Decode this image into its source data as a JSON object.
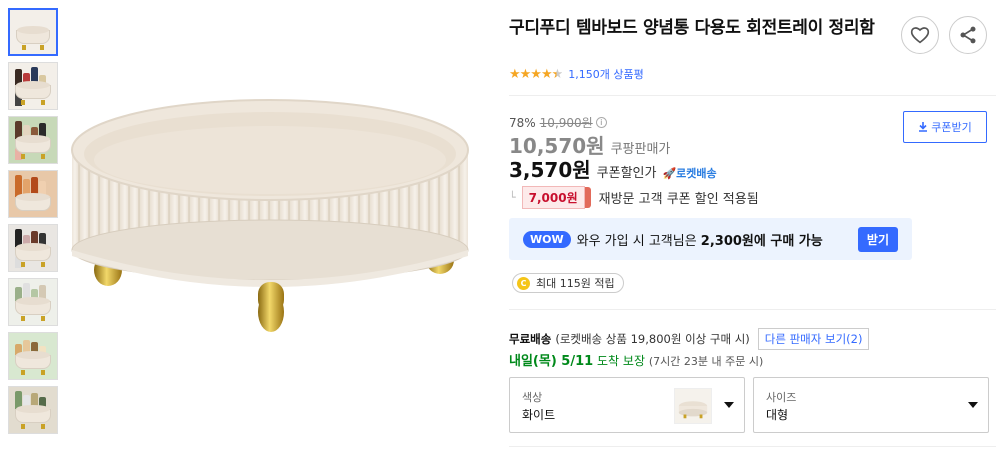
{
  "product": {
    "title": "구디푸디 템바보드 양념통 다용도 회전트레이 정리함",
    "rating_stars": "★★★★★",
    "rating_value": 4.5,
    "review_count": "1,150개 상품평"
  },
  "pricing": {
    "discount_rate": "78%",
    "original_price": "10,900원",
    "info_symbol": "i",
    "coupang_price": "10,570원",
    "coupang_price_label": "쿠팡판매가",
    "coupon_price": "3,570원",
    "coupon_price_label": "쿠폰할인가",
    "rocket_label": "🚀로켓배송",
    "revisit_corner": "└",
    "revisit_price": "7,000원",
    "revisit_text": "재방문 고객 쿠폰 할인 적용됨",
    "coupon_button": "쿠폰받기"
  },
  "wow": {
    "badge": "WOW",
    "text_prefix": "와우 가입 시 고객님은 ",
    "text_amount": "2,300원에 구매 가능",
    "join_button": "받기"
  },
  "reward": {
    "coin": "C",
    "text": "최대 115원 적립"
  },
  "shipping": {
    "free_label": "무료배송",
    "condition": "(로켓배송 상품 19,800원 이상 구매 시)",
    "other_seller": "다른 판매자 보기(2)",
    "arrival_day": "내일(목) 5/11",
    "arrival_suffix": "도착 보장",
    "arrival_note": "(7시간 23분 내 주문 시)"
  },
  "options": [
    {
      "label": "색상",
      "value": "화이트"
    },
    {
      "label": "사이즈",
      "value": "대형"
    }
  ],
  "icons": {
    "wish": "heart-icon",
    "share": "share-icon",
    "coupon": "download-icon"
  },
  "colors": {
    "accent": "#346aff",
    "star": "#f5a623",
    "danger": "#c8102e",
    "success": "#00891a"
  }
}
